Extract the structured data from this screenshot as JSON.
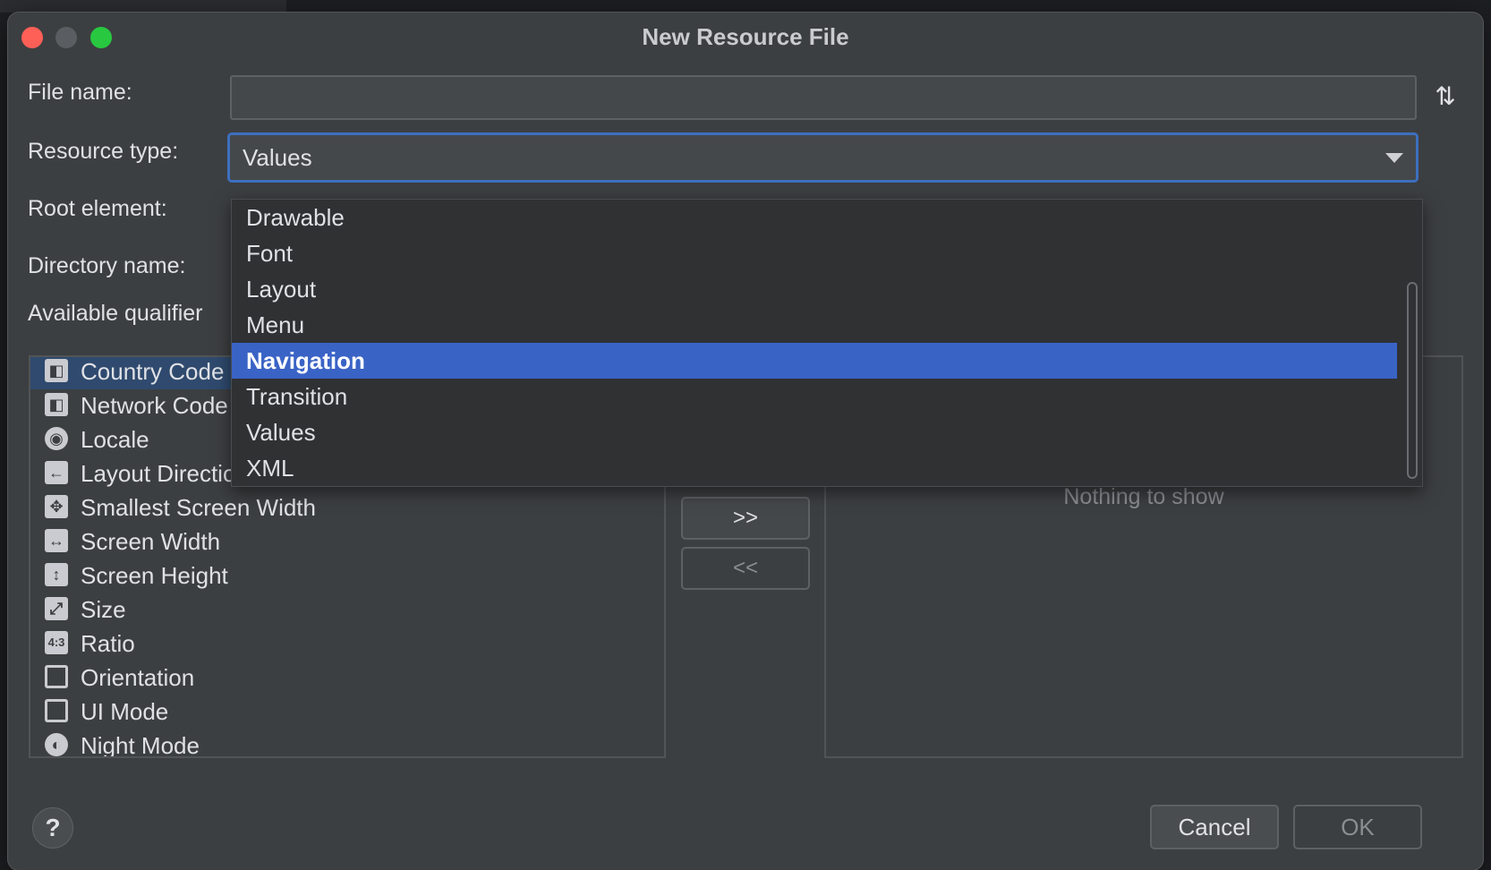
{
  "dialog": {
    "title": "New Resource File"
  },
  "form": {
    "file_name_label": "File name:",
    "file_name_value": "",
    "resource_type_label": "Resource type:",
    "resource_type_value": "Values",
    "root_element_label": "Root element:",
    "directory_name_label": "Directory name:",
    "available_qualifiers_label": "Available qualifier"
  },
  "qualifiers": [
    {
      "label": "Country Code",
      "icon": "country-code-icon",
      "selected": true
    },
    {
      "label": "Network Code",
      "icon": "network-code-icon",
      "selected": false
    },
    {
      "label": "Locale",
      "icon": "globe-icon",
      "selected": false
    },
    {
      "label": "Layout Direction",
      "icon": "layout-direction-icon",
      "selected": false
    },
    {
      "label": "Smallest Screen Width",
      "icon": "smallest-screen-width-icon",
      "selected": false
    },
    {
      "label": "Screen Width",
      "icon": "screen-width-icon",
      "selected": false
    },
    {
      "label": "Screen Height",
      "icon": "screen-height-icon",
      "selected": false
    },
    {
      "label": "Size",
      "icon": "size-icon",
      "selected": false
    },
    {
      "label": "Ratio",
      "icon": "ratio-icon",
      "selected": false
    },
    {
      "label": "Orientation",
      "icon": "orientation-icon",
      "selected": false
    },
    {
      "label": "UI Mode",
      "icon": "ui-mode-icon",
      "selected": false
    },
    {
      "label": "Night Mode",
      "icon": "night-mode-icon",
      "selected": false
    }
  ],
  "buttons": {
    "add": ">>",
    "remove": "<<",
    "cancel": "Cancel",
    "ok": "OK",
    "help": "?"
  },
  "chosen": {
    "empty_text": "Nothing to show"
  },
  "dropdown": {
    "options": [
      "Drawable",
      "Font",
      "Layout",
      "Menu",
      "Navigation",
      "Transition",
      "Values",
      "XML"
    ],
    "highlighted": "Navigation"
  },
  "colors": {
    "accent": "#3a63c6",
    "focus_border": "#3d6fbf",
    "close": "#fe5f57",
    "maximize": "#28c840"
  }
}
